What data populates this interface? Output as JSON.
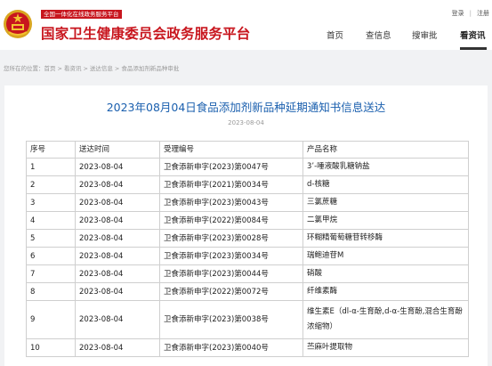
{
  "header": {
    "gov_tag": "全国一体化在线政务服务平台",
    "site_title": "国家卫生健康委员会政务服务平台",
    "login": "登录",
    "register": "注册",
    "nav": [
      "首页",
      "查信息",
      "搜审批",
      "看资讯"
    ],
    "active_nav": "看资讯",
    "accent_color": "#c8161e"
  },
  "breadcrumb": {
    "prefix": "您所在的位置：",
    "items": [
      "首页",
      "看资讯",
      "送达信息",
      "食品添加剂新品种审批"
    ],
    "separator": ">"
  },
  "article": {
    "title": "2023年08月04日食品添加剂新品种延期通知书信息送达",
    "date": "2023-08-04",
    "title_color": "#1a5fae"
  },
  "table": {
    "headers": [
      "序号",
      "送达时间",
      "受理编号",
      "产品名称"
    ],
    "rows": [
      {
        "no": "1",
        "date": "2023-08-04",
        "code": "卫食添新申字(2023)第0047号",
        "name": "3’-唾液酸乳糖钠盐"
      },
      {
        "no": "2",
        "date": "2023-08-04",
        "code": "卫食添新申字(2021)第0034号",
        "name": "d-核糖"
      },
      {
        "no": "3",
        "date": "2023-08-04",
        "code": "卫食添新申字(2023)第0043号",
        "name": "三氯蔗糖"
      },
      {
        "no": "4",
        "date": "2023-08-04",
        "code": "卫食添新申字(2022)第0084号",
        "name": "二氯甲烷"
      },
      {
        "no": "5",
        "date": "2023-08-04",
        "code": "卫食添新申字(2023)第0028号",
        "name": "环糊精葡萄糖苷转移酶"
      },
      {
        "no": "6",
        "date": "2023-08-04",
        "code": "卫食添新申字(2023)第0034号",
        "name": "瑞鲍迪苷M"
      },
      {
        "no": "7",
        "date": "2023-08-04",
        "code": "卫食添新申字(2023)第0044号",
        "name": "硝酸"
      },
      {
        "no": "8",
        "date": "2023-08-04",
        "code": "卫食添新申字(2022)第0072号",
        "name": "纤维素酶"
      },
      {
        "no": "9",
        "date": "2023-08-04",
        "code": "卫食添新申字(2023)第0038号",
        "name": "维生素E（dl-α-生育酚,d-α-生育酚,混合生育酚浓缩物）"
      },
      {
        "no": "10",
        "date": "2023-08-04",
        "code": "卫食添新申字(2023)第0040号",
        "name": "苎麻叶提取物"
      }
    ]
  }
}
